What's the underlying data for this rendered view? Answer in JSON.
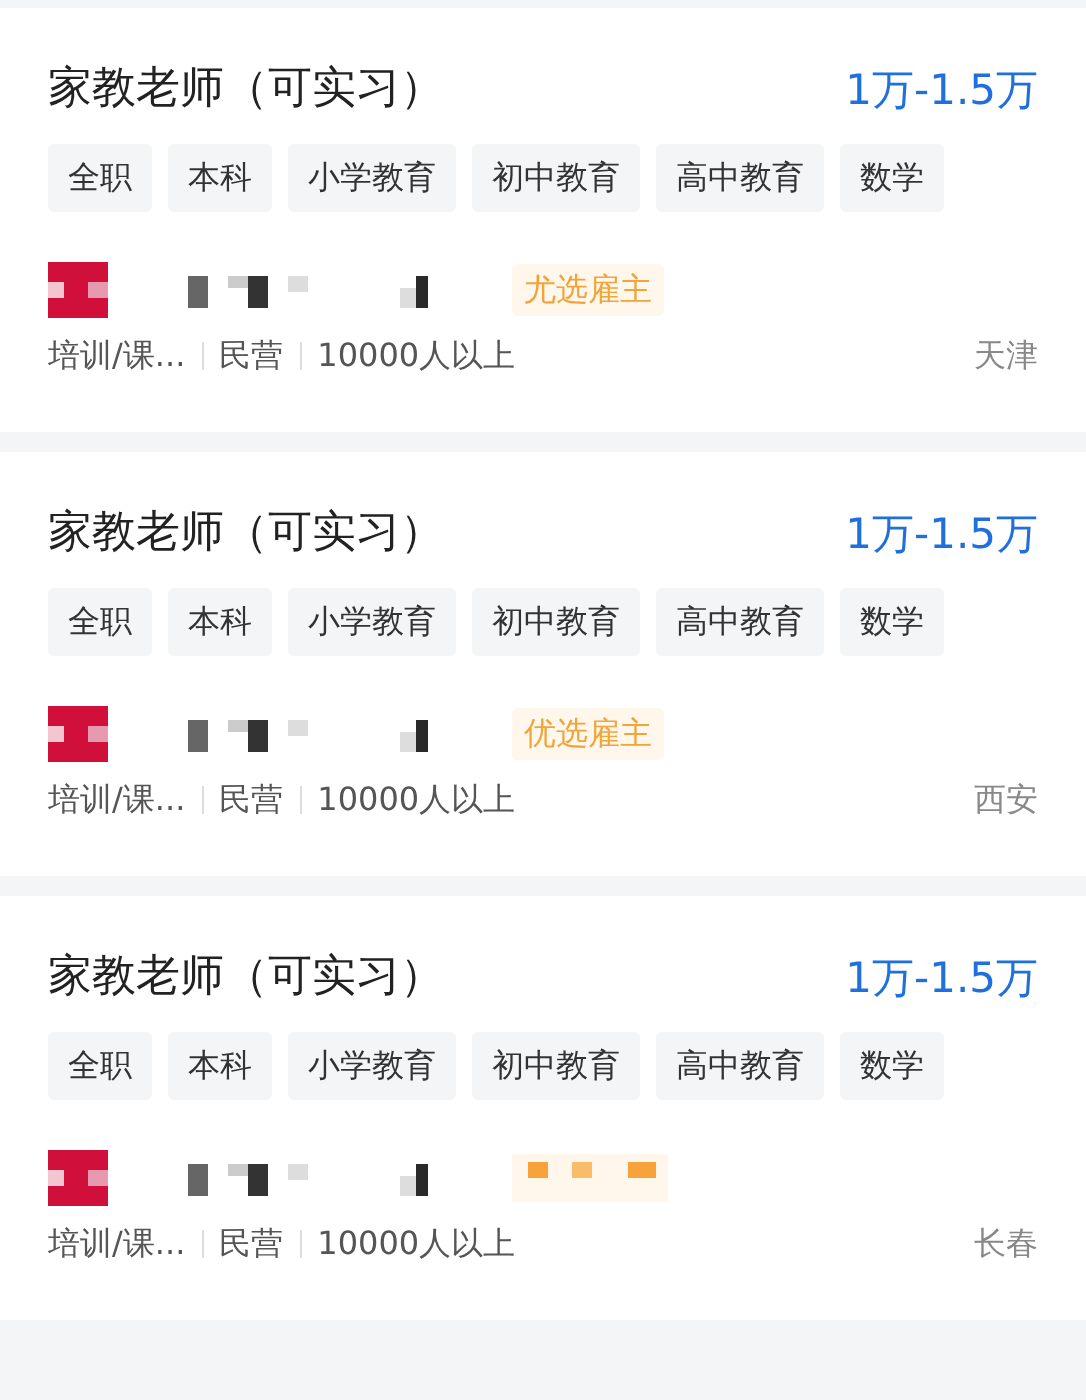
{
  "jobs": [
    {
      "title": "家教老师（可实习）",
      "salary": "1万-1.5万",
      "tags": [
        "全职",
        "本科",
        "小学教育",
        "初中教育",
        "高中教育",
        "数学"
      ],
      "badge": {
        "kind": "text",
        "text": "尤选雇主"
      },
      "meta": [
        "培训/课...",
        "民营",
        "10000人以上"
      ],
      "city": "天津"
    },
    {
      "title": "家教老师（可实习）",
      "salary": "1万-1.5万",
      "tags": [
        "全职",
        "本科",
        "小学教育",
        "初中教育",
        "高中教育",
        "数学"
      ],
      "badge": {
        "kind": "text",
        "text": "优选雇主"
      },
      "meta": [
        "培训/课...",
        "民营",
        "10000人以上"
      ],
      "city": "西安"
    },
    {
      "title": "家教老师（可实习）",
      "salary": "1万-1.5万",
      "tags": [
        "全职",
        "本科",
        "小学教育",
        "初中教育",
        "高中教育",
        "数学"
      ],
      "badge": {
        "kind": "redacted"
      },
      "meta": [
        "培训/课...",
        "民营",
        "10000人以上"
      ],
      "city": "长春"
    }
  ]
}
